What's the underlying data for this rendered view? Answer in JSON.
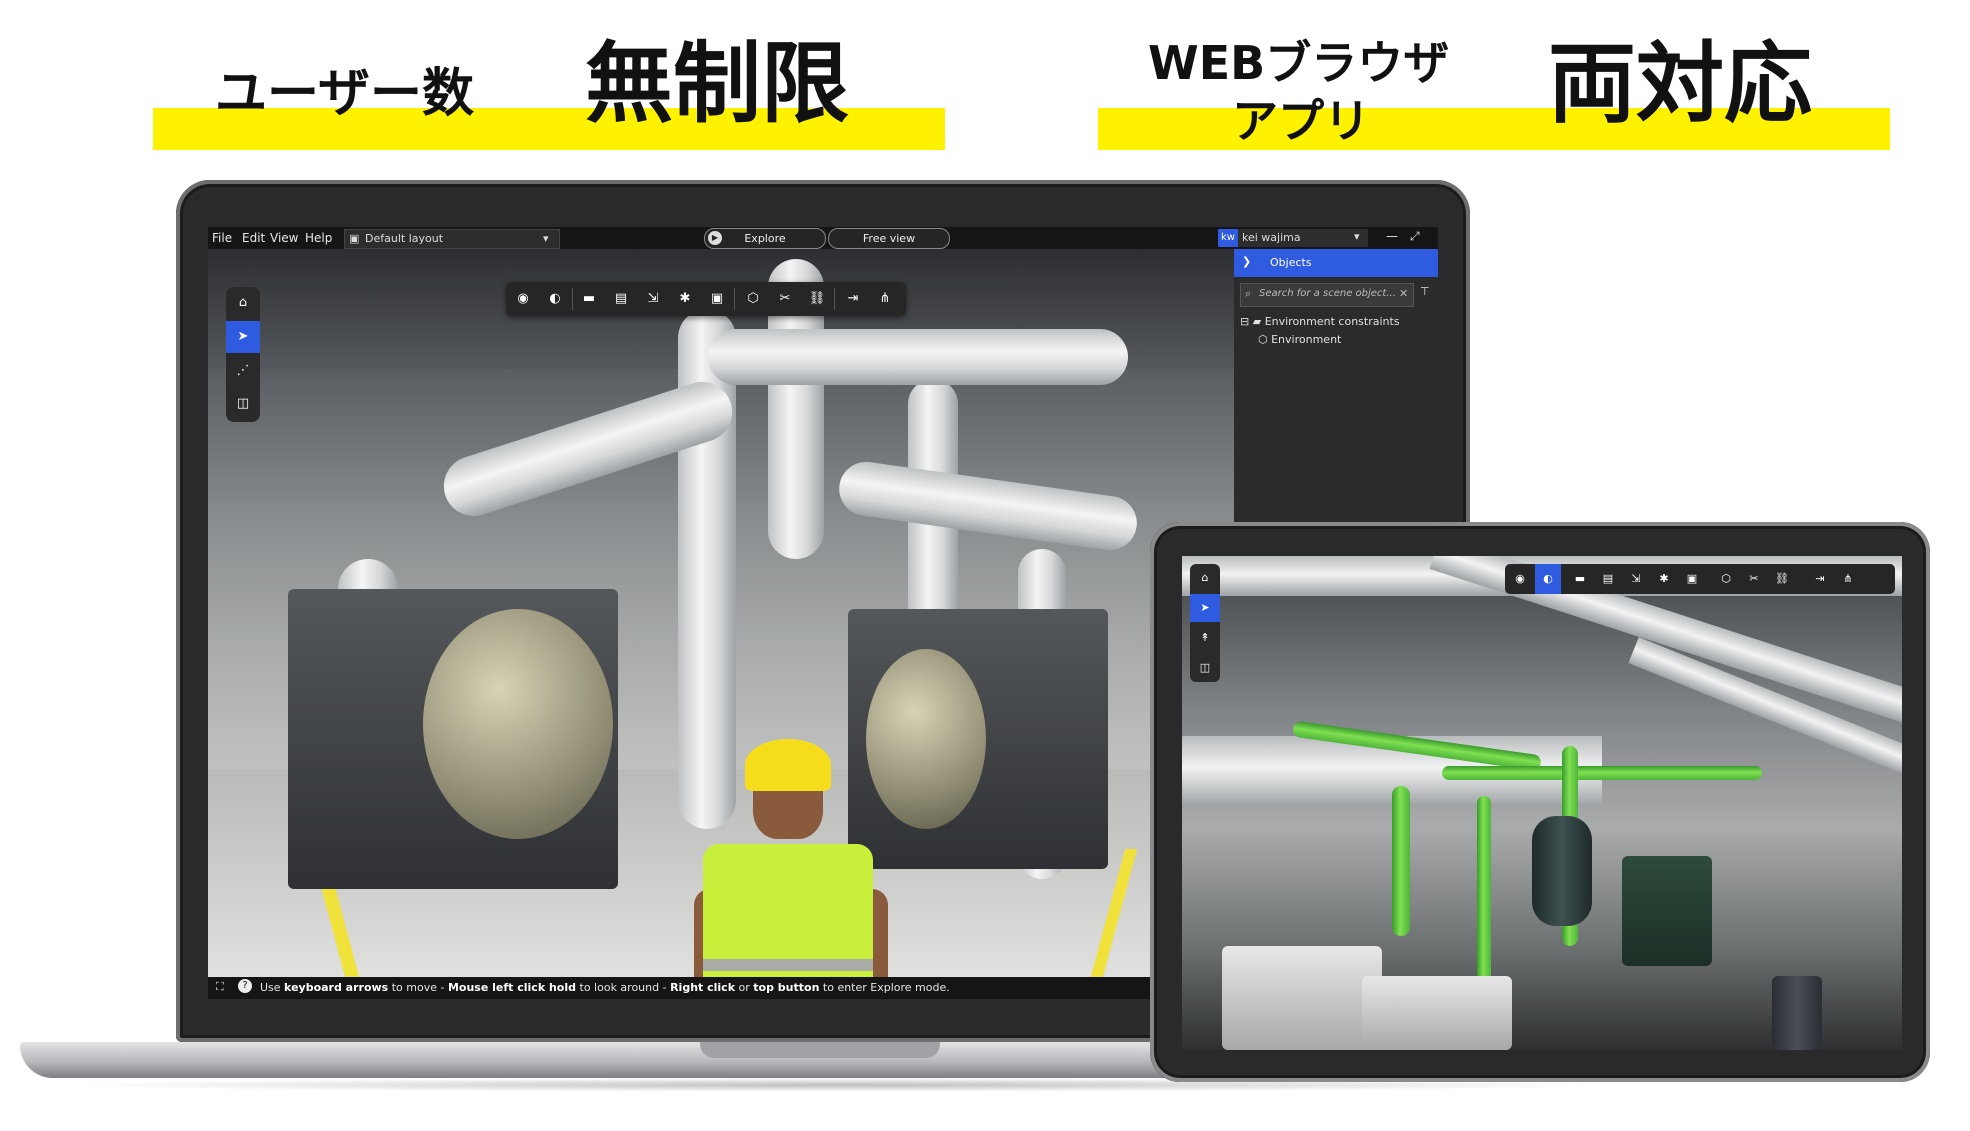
{
  "headlines": {
    "left_prefix": "ユーザー数",
    "left_main": "無制限",
    "right_prefix_line1": "WEBブラウザ",
    "right_prefix_line2": "アプリ",
    "right_main": "両対応"
  },
  "accent_colors": {
    "highlight": "#fff200",
    "active": "#2f5be0"
  },
  "laptop_app": {
    "menu": [
      "File",
      "Edit",
      "View",
      "Help"
    ],
    "layout_select": "Default layout",
    "mode_buttons": {
      "explore": "Explore",
      "free_view": "Free view"
    },
    "user": {
      "initials": "kw",
      "name": "kei wajima"
    },
    "left_tools": [
      "home-icon",
      "navigate-icon",
      "steps-icon",
      "vr-icon"
    ],
    "toolbar_icons": [
      "eye-icon",
      "contrast-icon",
      "measure-icon",
      "comment-icon",
      "import-icon",
      "capture-icon",
      "screenshot-icon",
      "cube-icon",
      "cut-icon",
      "link-icon",
      "export-icon",
      "share-icon"
    ],
    "panel": {
      "title": "Objects",
      "search_placeholder": "Search for a scene object...",
      "tree": [
        "Environment constraints",
        "Environment"
      ]
    },
    "status": {
      "part1": "Use ",
      "bold1": "keyboard arrows",
      "part2": " to move - ",
      "bold2": "Mouse left click hold",
      "part3": " to look around - ",
      "bold3": "Right click",
      "part4": " or ",
      "bold4": "top button",
      "part5": " to enter Explore mode."
    }
  },
  "tablet_app": {
    "left_tools": [
      "home-icon",
      "navigate-icon",
      "walk-icon",
      "vr-icon"
    ],
    "toolbar_icons": [
      "eye-icon",
      "contrast-icon",
      "measure-icon",
      "comment-icon",
      "import-icon",
      "capture-icon",
      "screenshot-icon",
      "cube-icon",
      "cut-icon",
      "link-icon",
      "export-icon",
      "share-icon"
    ]
  }
}
